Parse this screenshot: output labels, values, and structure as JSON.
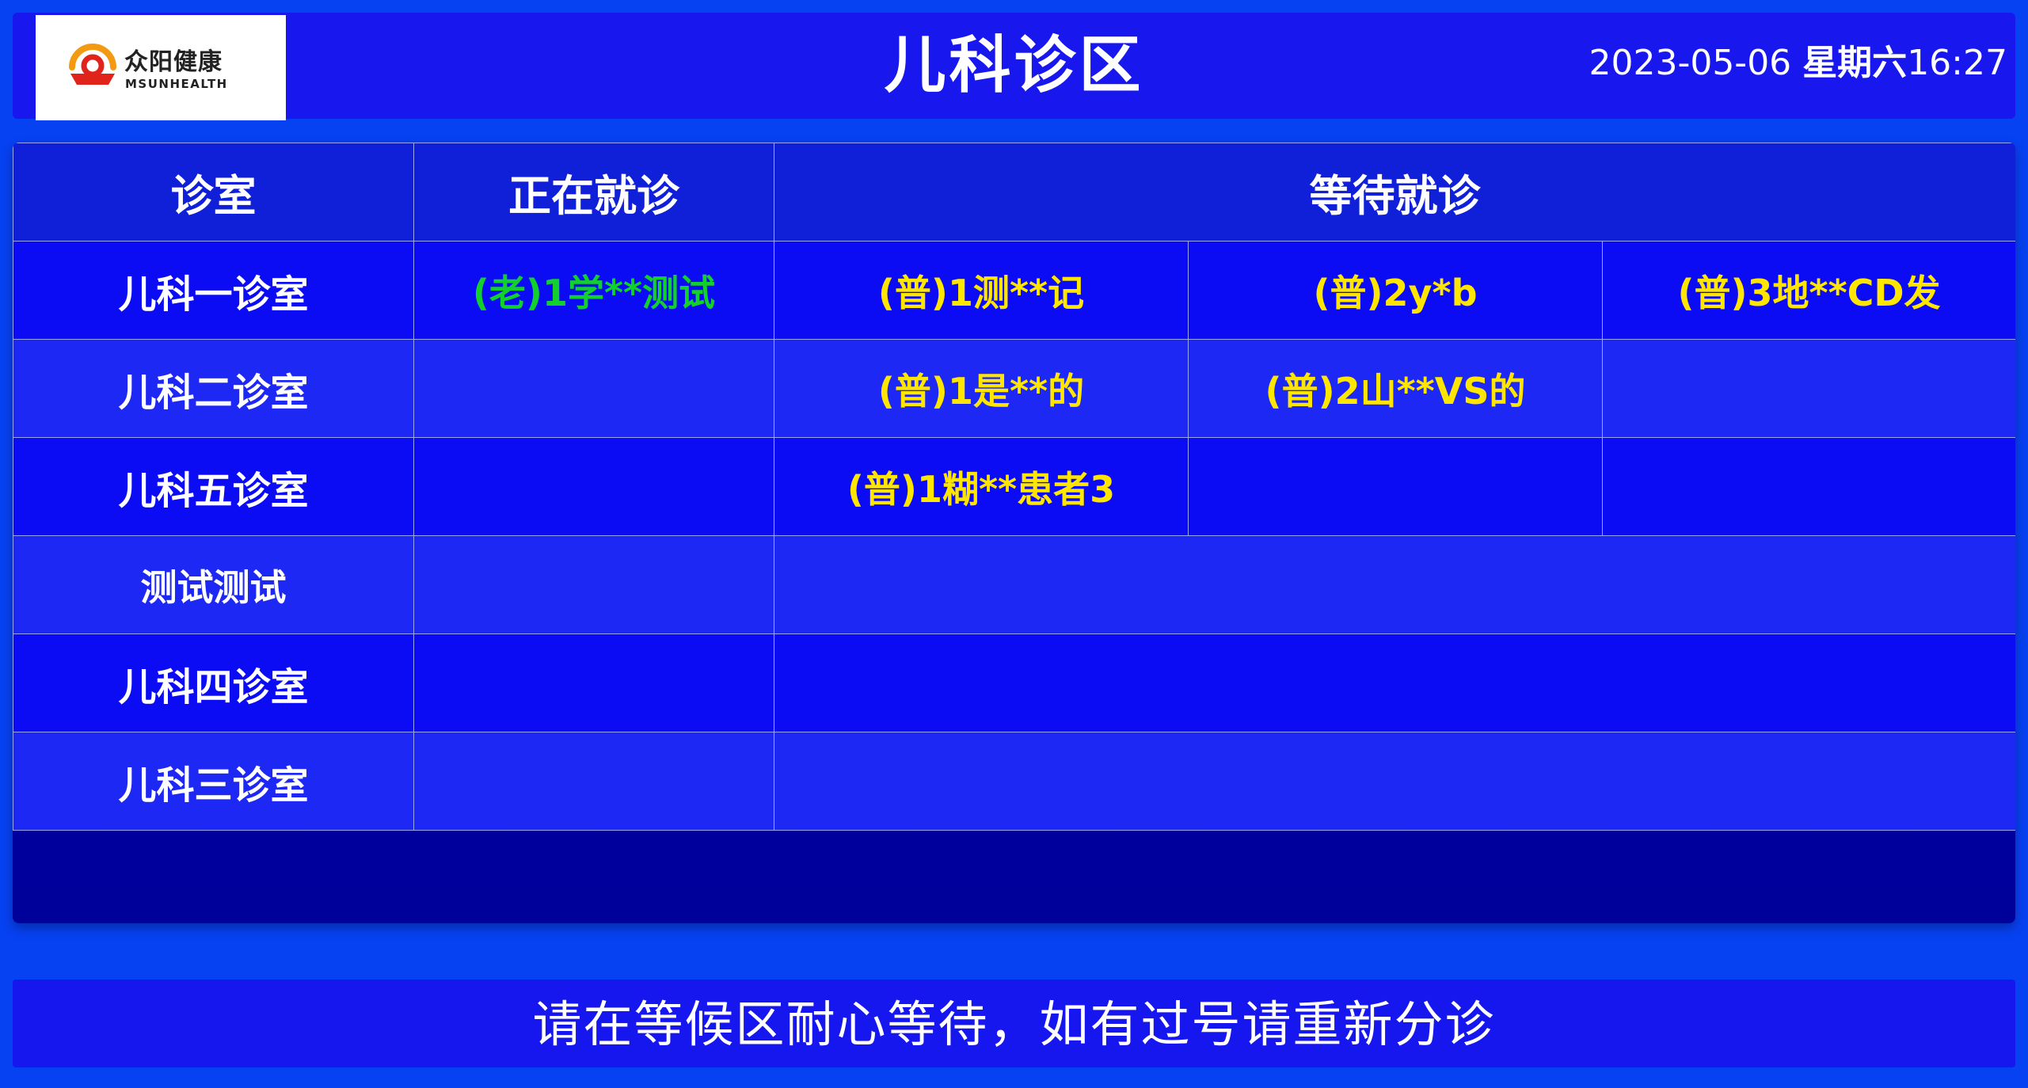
{
  "header": {
    "logo": {
      "name_cn": "众阳健康",
      "name_en": "MSUNHEALTH"
    },
    "title": "儿科诊区",
    "date": "2023-05-06",
    "weekday": "星期六",
    "time": "16:27"
  },
  "table": {
    "headers": {
      "room": "诊室",
      "current": "正在就诊",
      "waiting": "等待就诊"
    },
    "rows": [
      {
        "room": "儿科一诊室",
        "current": "(老)1学**测试",
        "waiting": [
          "(普)1测**记",
          "(普)2y*b",
          "(普)3地**CD发"
        ]
      },
      {
        "room": "儿科二诊室",
        "current": "",
        "waiting": [
          "(普)1是**的",
          "(普)2山**VS的",
          ""
        ]
      },
      {
        "room": "儿科五诊室",
        "current": "",
        "waiting": [
          "(普)1糊**患者3",
          "",
          ""
        ]
      },
      {
        "room": "测试测试",
        "current": "",
        "waiting": []
      },
      {
        "room": "儿科四诊室",
        "current": "",
        "waiting": []
      },
      {
        "room": "儿科三诊室",
        "current": "",
        "waiting": []
      }
    ]
  },
  "footer": {
    "notice": "请在等候区耐心等待，如有过号请重新分诊"
  },
  "colors": {
    "background": "#0742f2",
    "panel": "#1818ee",
    "current_patient": "#12d12c",
    "waiting_patient": "#ffe600",
    "logo_red": "#e0241b",
    "logo_orange": "#f39a12"
  }
}
